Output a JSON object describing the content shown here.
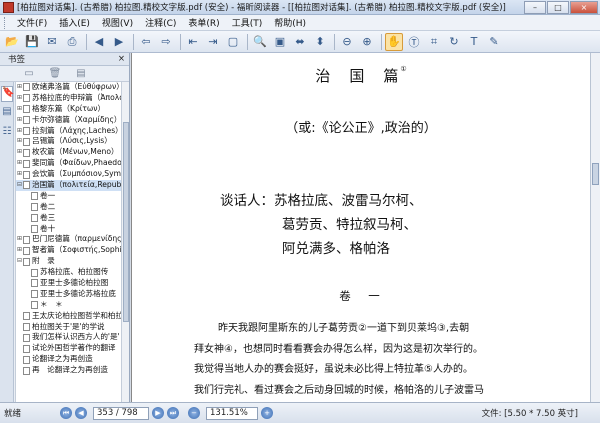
{
  "window": {
    "title": "[柏拉图对话集]. (古希腊) 柏拉图.精校文字版.pdf (安全) - 福昕阅读器 - [[柏拉图对话集]. (古希腊) 柏拉图.精校文字版.pdf (安全)]",
    "minimize": "–",
    "maximize": "□",
    "close": "×"
  },
  "menu": [
    "文件(F)",
    "插入(E)",
    "视图(V)",
    "注释(C)",
    "表单(R)",
    "工具(T)",
    "帮助(H)"
  ],
  "sidebar": {
    "header": "书签",
    "bookmarks": [
      {
        "label": "欧绪弗洛篇（Εὐθύφρων）",
        "toggle": "⊞"
      },
      {
        "label": "苏格拉底的申辩篇（Ἀπολογία）",
        "toggle": "⊞"
      },
      {
        "label": "格黎东篇（Κρίτων）",
        "toggle": "⊞"
      },
      {
        "label": "卡尔弥德篇（Χαρμίδης）",
        "toggle": "⊞"
      },
      {
        "label": "拉刻篇（Λάχης,Laches）",
        "toggle": "⊞"
      },
      {
        "label": "吕锡篇（Λύσις,Lysis）",
        "toggle": "⊞"
      },
      {
        "label": "枚农篇（Μένων,Meno）",
        "toggle": "⊞"
      },
      {
        "label": "斐同篇（Φαίδων,Phaedo）",
        "toggle": "⊞"
      },
      {
        "label": "会饮篇（Συμπόσιον,Symposium）",
        "toggle": "⊞"
      },
      {
        "label": "治国篇（πολιτεία,Republic）",
        "toggle": "⊟",
        "selected": true
      },
      {
        "label": "卷一",
        "indent": 1
      },
      {
        "label": "卷二",
        "indent": 1
      },
      {
        "label": "卷三",
        "indent": 1
      },
      {
        "label": "卷十",
        "indent": 1
      },
      {
        "label": "巴门尼德篇（παρμενίδης）",
        "toggle": "⊞"
      },
      {
        "label": "智者篇（Σοφιστής,Sophist）",
        "toggle": "⊞"
      },
      {
        "label": "附　录",
        "toggle": "⊟"
      },
      {
        "label": "苏格拉底、柏拉图传",
        "indent": 1
      },
      {
        "label": "亚里士多德论柏拉图",
        "indent": 1
      },
      {
        "label": "亚里士多德论苏格拉底",
        "indent": 1
      },
      {
        "label": "＊　＊",
        "indent": 1
      },
      {
        "label": "王太庆论柏拉图哲学和柏拉图译本"
      },
      {
        "label": "柏拉图关于'是'的学说"
      },
      {
        "label": "我们怎样认识西方人的'是'"
      },
      {
        "label": "试论外国哲学著作的翻译"
      },
      {
        "label": "论翻译之为再创造"
      },
      {
        "label": "再　论翻译之为再创造"
      }
    ]
  },
  "document": {
    "title": "治　国　篇",
    "title_note": "①",
    "subtitle": "（或:《论公正》,政治的）",
    "speakers_line1": "谈话人：苏格拉底、波雷马尔柯、",
    "speakers_line2": "葛劳贡、特拉叙马柯、",
    "speakers_line3": "阿兑满多、格帕洛",
    "volume": "卷　一",
    "lines": [
      "昨天我跟阿里斯东的儿子葛劳贡②一道下到贝莱坞③,去朝",
      "拜女神④，也想同时看看赛会办得怎么样，因为这是初次举行的。",
      "我觉得当地人办的赛会挺好，虽说未必比得上特拉革⑤人办的。",
      "我们行完礼、看过赛会之后动身回城的时候，格帕洛的儿子波雷马"
    ]
  },
  "status": {
    "ready": "就绪",
    "page": "353 / 798",
    "zoom": "131.51%",
    "file_info": "文件: [5.50 * 7.50 英寸]"
  }
}
